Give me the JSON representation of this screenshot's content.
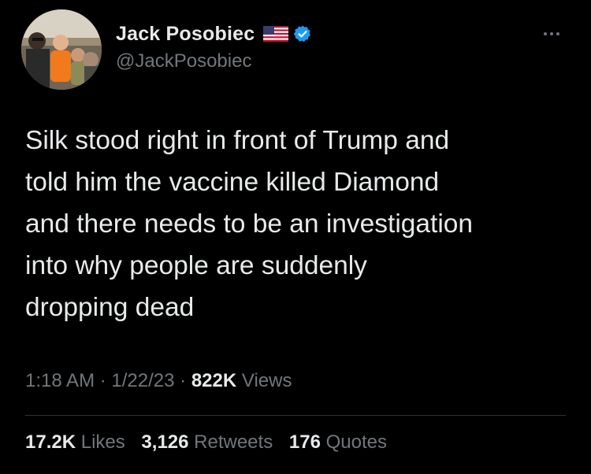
{
  "user": {
    "display_name": "Jack Posobiec",
    "handle": "@JackPosobiec",
    "flag_icon": "us-flag-icon",
    "verified_icon": "verified-badge-icon",
    "verified_color": "#1d9bf0"
  },
  "tweet": {
    "text_lines": [
      "Silk stood right in front of Trump and",
      "told him the vaccine killed Diamond",
      "and there needs to be an investigation",
      "into why people are suddenly",
      "dropping dead"
    ],
    "time": "1:18 AM",
    "date": "1/22/23",
    "separator": "·",
    "views_count": "822K",
    "views_label": "Views"
  },
  "stats": {
    "likes": {
      "count": "17.2K",
      "label": "Likes"
    },
    "retweets": {
      "count": "3,126",
      "label": "Retweets"
    },
    "quotes": {
      "count": "176",
      "label": "Quotes"
    }
  },
  "colors": {
    "background": "#000000",
    "primary_text": "#e7e9ea",
    "secondary_text": "#71767b",
    "divider": "#2f3336"
  }
}
